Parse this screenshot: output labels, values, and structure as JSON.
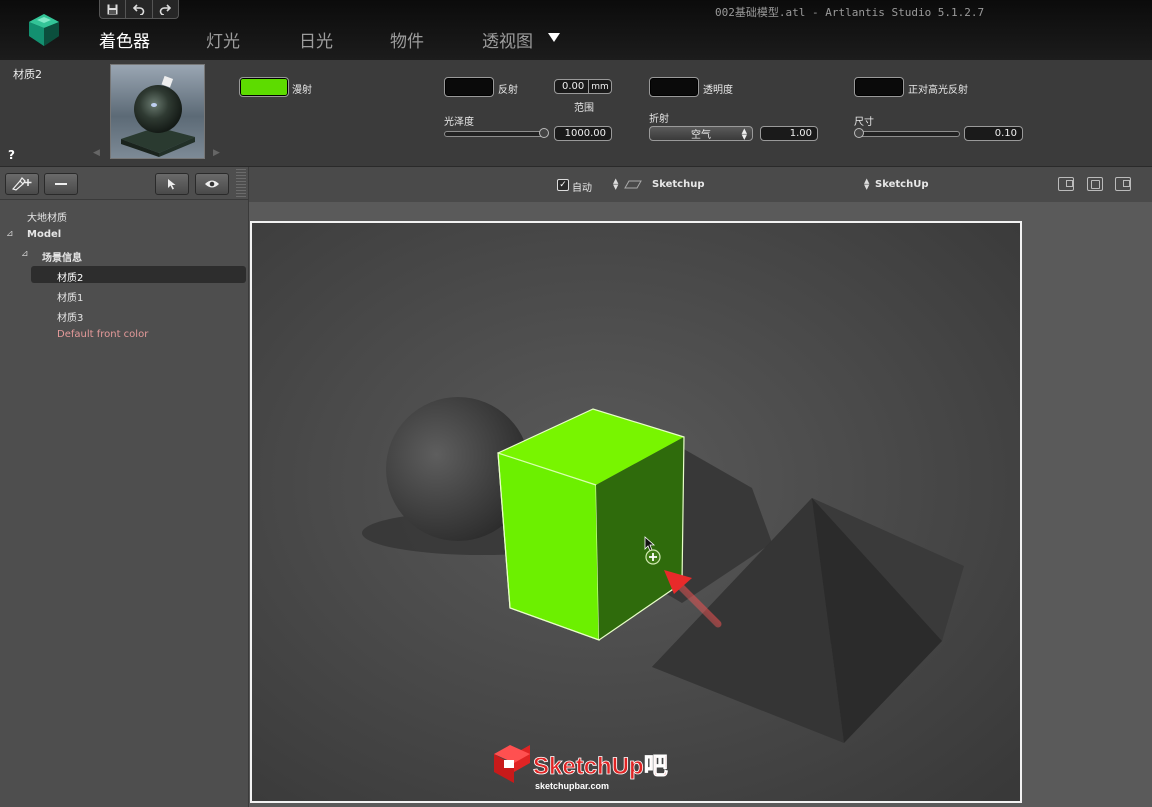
{
  "window_title": "002基础模型.atl - Artlantis Studio 5.1.2.7",
  "quick_access": {
    "save": "save-icon",
    "undo": "undo-icon",
    "redo": "redo-icon"
  },
  "tabs": [
    {
      "label": "着色器",
      "active": true
    },
    {
      "label": "灯光"
    },
    {
      "label": "日光"
    },
    {
      "label": "物件"
    },
    {
      "label": "透视图"
    }
  ],
  "material": {
    "name": "材质2",
    "help": "?",
    "diffuse_label": "漫射",
    "diffuse_color": "#5ddc00",
    "reflection_label": "反射",
    "reflection_color": "#0a0a0a",
    "range_value": "0.00",
    "range_unit": "mm",
    "range_label": "范围",
    "glossiness_label": "光泽度",
    "glossiness_value": "1000.00",
    "glossiness_level": 1.0,
    "transparency_label": "透明度",
    "transparency_color": "#0a0a0a",
    "refraction_label": "折射",
    "refraction_medium": "空气",
    "refraction_value": "1.00",
    "specular_label": "正对高光反射",
    "specular_color": "#0a0a0a",
    "size_label": "尺寸",
    "size_value": "0.10",
    "size_level": 0.0
  },
  "tree": {
    "ground": "大地材质",
    "model": "Model",
    "scene_info": "场景信息",
    "materials": [
      "材质2",
      "材质1",
      "材质3"
    ],
    "default_color": "Default front color",
    "default_color_hex": "#e59a9a"
  },
  "viewport_toolbar": {
    "auto_label": "自动",
    "auto_checked": true,
    "layer1": "Sketchup",
    "layer2": "SketchUp"
  },
  "scene": {
    "cube_color": "#6cf000",
    "watermark": "SketchUp吧",
    "watermark_url": "sketchupbar.com"
  }
}
